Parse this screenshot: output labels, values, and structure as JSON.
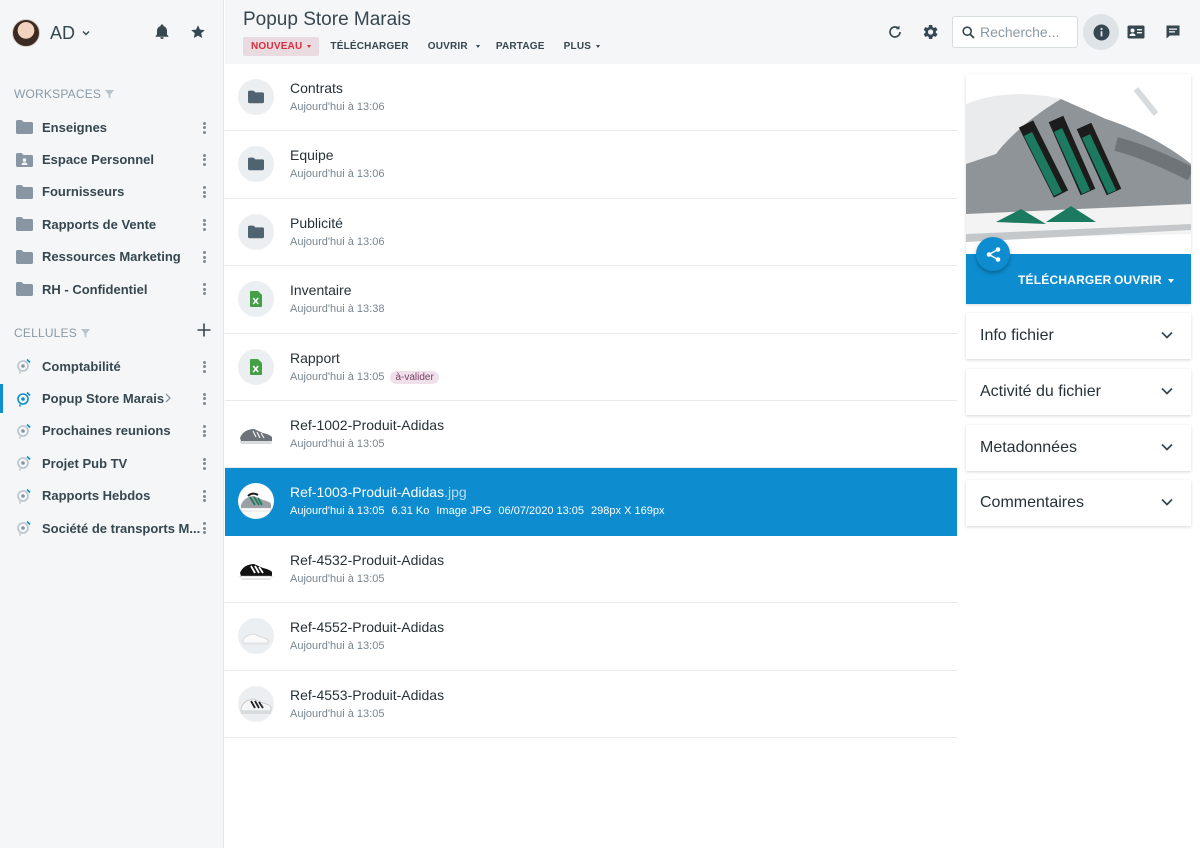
{
  "user": {
    "initials": "AD"
  },
  "workspaces": {
    "title": "WORKSPACES",
    "items": [
      {
        "label": "Enseignes",
        "icon": "folder-icon"
      },
      {
        "label": "Espace Personnel",
        "icon": "personal-folder-icon"
      },
      {
        "label": "Fournisseurs",
        "icon": "folder-icon"
      },
      {
        "label": "Rapports de Vente",
        "icon": "folder-icon"
      },
      {
        "label": "Ressources Marketing",
        "icon": "folder-icon"
      },
      {
        "label": "RH - Confidentiel",
        "icon": "folder-icon"
      }
    ]
  },
  "cells": {
    "title": "CELLULES",
    "items": [
      {
        "label": "Comptabilité"
      },
      {
        "label": "Popup Store Marais",
        "active": true
      },
      {
        "label": "Prochaines reunions"
      },
      {
        "label": "Projet Pub TV"
      },
      {
        "label": "Rapports Hebdos"
      },
      {
        "label": "Société de transports M..."
      }
    ]
  },
  "header": {
    "title": "Popup Store Marais",
    "toolbar": {
      "new": "NOUVEAU",
      "download": "TÉLÉCHARGER",
      "open": "OUVRIR",
      "share": "PARTAGE",
      "more": "PLUS"
    },
    "search_placeholder": "Recherche..."
  },
  "files": [
    {
      "name": "Contrats",
      "date": "Aujourd'hui à 13:06",
      "type": "folder"
    },
    {
      "name": "Equipe",
      "date": "Aujourd'hui à 13:06",
      "type": "folder"
    },
    {
      "name": "Publicité",
      "date": "Aujourd'hui à 13:06",
      "type": "folder"
    },
    {
      "name": "Inventaire",
      "date": "Aujourd'hui à 13:38",
      "type": "spreadsheet"
    },
    {
      "name": "Rapport",
      "date": "Aujourd'hui à 13:05",
      "type": "spreadsheet",
      "tag": "à-valider"
    },
    {
      "name": "Ref-1002-Produit-Adidas",
      "date": "Aujourd'hui à 13:05",
      "type": "image"
    },
    {
      "name": "Ref-1003-Produit-Adidas",
      "ext": ".jpg",
      "date": "Aujourd'hui à 13:05",
      "size": "6.31 Ko",
      "kind": "Image JPG",
      "modified": "06/07/2020 13:05",
      "dimensions": "298px X 169px",
      "type": "image",
      "selected": true
    },
    {
      "name": "Ref-4532-Produit-Adidas",
      "date": "Aujourd'hui à 13:05",
      "type": "image"
    },
    {
      "name": "Ref-4552-Produit-Adidas",
      "date": "Aujourd'hui à 13:05",
      "type": "image"
    },
    {
      "name": "Ref-4553-Produit-Adidas",
      "date": "Aujourd'hui à 13:05",
      "type": "image"
    }
  ],
  "preview": {
    "download": "TÉLÉCHARGER",
    "open": "OUVRIR"
  },
  "panels": [
    {
      "label": "Info fichier"
    },
    {
      "label": "Activité du fichier"
    },
    {
      "label": "Metadonnées"
    },
    {
      "label": "Commentaires"
    }
  ],
  "colors": {
    "accent": "#0d8dd0",
    "danger": "#d6303e",
    "sidebar_bg": "#f4f6f8"
  }
}
